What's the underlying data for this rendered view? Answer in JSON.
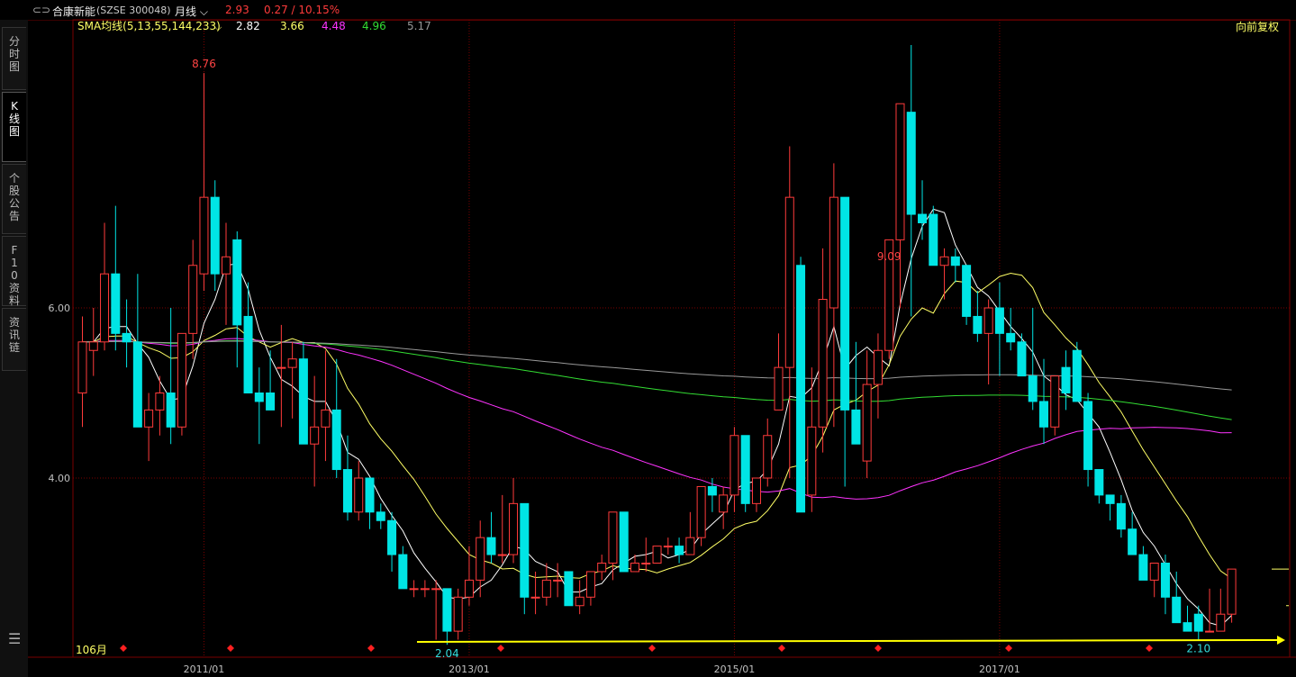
{
  "header": {
    "window_icon": "link-icon",
    "stock_name": "合康新能",
    "stock_code": "(SZSE 300048)",
    "period": "月线",
    "last_price": "2.93",
    "change": "0.27 / 10.15%"
  },
  "sma": {
    "label": "SMA均线(5,13,55,144,233)",
    "values": [
      {
        "value": "2.82",
        "color": "#ffffff"
      },
      {
        "value": "3.66",
        "color": "#ffff66"
      },
      {
        "value": "4.48",
        "color": "#ff33ff"
      },
      {
        "value": "4.96",
        "color": "#33dd33"
      },
      {
        "value": "5.17",
        "color": "#999999"
      }
    ]
  },
  "adjust_label": "向前复权",
  "side_tabs": [
    "分时图",
    "K线图",
    "个股公告",
    "F10资料",
    "资讯链"
  ],
  "active_tab": 1,
  "menu_icon": "hamburger-menu-icon",
  "bottom_label": "106月",
  "colors": {
    "up": "#ff3b3b",
    "down": "#00e5e5",
    "grid": "#7a0000",
    "axis_text": "#c0c0c0"
  },
  "chart_data": {
    "type": "candlestick",
    "y_tick_labels": [
      "6.00",
      "4.00"
    ],
    "x_tick_labels": [
      "2011/01",
      "2013/01",
      "2015/01",
      "2017/01"
    ],
    "high_annotations": [
      {
        "index": 11,
        "value": "8.76"
      },
      {
        "index": 73,
        "value": "9.09"
      }
    ],
    "low_annotations": [
      {
        "index": 33,
        "value": "2.04"
      },
      {
        "index": 101,
        "value": "2.10"
      }
    ],
    "ohlc": [
      [
        5.0,
        5.9,
        4.6,
        5.6
      ],
      [
        5.5,
        6.0,
        5.2,
        5.6
      ],
      [
        5.6,
        7.0,
        5.5,
        6.4
      ],
      [
        6.4,
        7.2,
        5.5,
        5.7
      ],
      [
        5.7,
        6.1,
        5.3,
        5.6
      ],
      [
        5.6,
        6.4,
        5.0,
        4.6
      ],
      [
        4.6,
        5.0,
        4.2,
        4.8
      ],
      [
        4.8,
        5.2,
        4.5,
        5.0
      ],
      [
        5.0,
        6.0,
        4.4,
        4.6
      ],
      [
        4.6,
        5.7,
        4.5,
        5.7
      ],
      [
        5.7,
        6.8,
        5.4,
        6.5
      ],
      [
        6.4,
        8.76,
        6.2,
        7.3
      ],
      [
        7.3,
        7.5,
        6.2,
        6.4
      ],
      [
        6.4,
        7.0,
        5.8,
        6.6
      ],
      [
        6.8,
        6.9,
        5.3,
        5.8
      ],
      [
        5.9,
        6.3,
        5.0,
        5.0
      ],
      [
        5.0,
        5.3,
        4.4,
        4.9
      ],
      [
        5.0,
        5.5,
        4.8,
        4.8
      ],
      [
        5.3,
        5.8,
        4.6,
        5.3
      ],
      [
        5.3,
        5.6,
        4.7,
        5.4
      ],
      [
        5.4,
        5.6,
        4.4,
        4.4
      ],
      [
        4.4,
        5.2,
        3.9,
        4.6
      ],
      [
        4.6,
        5.5,
        4.2,
        4.8
      ],
      [
        4.8,
        5.4,
        4.0,
        4.1
      ],
      [
        4.1,
        4.5,
        3.5,
        3.6
      ],
      [
        3.6,
        4.2,
        3.5,
        4.0
      ],
      [
        4.0,
        4.0,
        3.4,
        3.6
      ],
      [
        3.6,
        3.7,
        3.4,
        3.5
      ],
      [
        3.5,
        3.6,
        2.9,
        3.1
      ],
      [
        3.1,
        3.2,
        2.7,
        2.7
      ],
      [
        2.7,
        2.8,
        2.6,
        2.7
      ],
      [
        2.7,
        2.8,
        2.6,
        2.7
      ],
      [
        2.7,
        2.8,
        2.1,
        2.7
      ],
      [
        2.7,
        2.7,
        2.04,
        2.2
      ],
      [
        2.2,
        2.7,
        2.1,
        2.6
      ],
      [
        2.6,
        3.2,
        2.5,
        2.8
      ],
      [
        2.8,
        3.5,
        2.6,
        3.3
      ],
      [
        3.3,
        3.6,
        3.0,
        3.1
      ],
      [
        3.1,
        3.8,
        3.0,
        3.1
      ],
      [
        3.1,
        4.0,
        3.0,
        3.7
      ],
      [
        3.7,
        3.7,
        2.4,
        2.6
      ],
      [
        2.6,
        2.9,
        2.4,
        2.6
      ],
      [
        2.6,
        3.0,
        2.5,
        2.8
      ],
      [
        2.8,
        3.0,
        2.6,
        2.8
      ],
      [
        2.9,
        2.9,
        2.5,
        2.5
      ],
      [
        2.5,
        2.8,
        2.4,
        2.6
      ],
      [
        2.6,
        2.9,
        2.5,
        2.9
      ],
      [
        2.9,
        3.1,
        2.8,
        3.0
      ],
      [
        3.0,
        3.5,
        2.8,
        3.6
      ],
      [
        3.6,
        3.6,
        2.9,
        2.9
      ],
      [
        2.9,
        3.1,
        2.9,
        3.0
      ],
      [
        3.0,
        3.3,
        2.9,
        3.0
      ],
      [
        3.0,
        3.2,
        3.1,
        3.2
      ],
      [
        3.2,
        3.3,
        3.1,
        3.2
      ],
      [
        3.2,
        3.3,
        3.0,
        3.1
      ],
      [
        3.1,
        3.6,
        3.1,
        3.3
      ],
      [
        3.3,
        3.9,
        3.2,
        3.9
      ],
      [
        3.9,
        4.0,
        3.6,
        3.8
      ],
      [
        3.6,
        3.9,
        3.4,
        3.8
      ],
      [
        3.8,
        4.6,
        3.6,
        4.5
      ],
      [
        4.5,
        4.5,
        3.6,
        3.7
      ],
      [
        3.7,
        4.0,
        3.6,
        4.0
      ],
      [
        4.0,
        4.7,
        3.9,
        4.5
      ],
      [
        4.8,
        5.7,
        4.8,
        5.3
      ],
      [
        5.3,
        7.9,
        4.0,
        7.3
      ],
      [
        6.5,
        6.6,
        3.7,
        3.6
      ],
      [
        3.8,
        5.3,
        3.6,
        4.6
      ],
      [
        4.6,
        6.7,
        4.3,
        6.1
      ],
      [
        6.0,
        7.7,
        4.6,
        7.3
      ],
      [
        7.3,
        7.3,
        3.9,
        4.8
      ],
      [
        4.8,
        5.6,
        4.4,
        4.4
      ],
      [
        4.2,
        5.5,
        4.0,
        5.1
      ],
      [
        5.1,
        5.7,
        4.7,
        5.5
      ],
      [
        5.5,
        6.5,
        5.4,
        6.8
      ],
      [
        6.8,
        7.5,
        6.0,
        8.4
      ],
      [
        8.3,
        9.09,
        5.9,
        7.1
      ],
      [
        7.1,
        7.5,
        6.8,
        7.0
      ],
      [
        7.1,
        7.2,
        6.5,
        6.5
      ],
      [
        6.5,
        6.7,
        6.1,
        6.6
      ],
      [
        6.6,
        6.7,
        6.3,
        6.5
      ],
      [
        6.5,
        6.5,
        5.8,
        5.9
      ],
      [
        5.9,
        6.2,
        5.6,
        5.7
      ],
      [
        5.7,
        6.1,
        5.1,
        6.0
      ],
      [
        6.0,
        6.3,
        5.2,
        5.7
      ],
      [
        5.7,
        6.0,
        5.5,
        5.6
      ],
      [
        5.6,
        5.7,
        5.2,
        5.2
      ],
      [
        5.2,
        6.0,
        4.8,
        4.9
      ],
      [
        4.9,
        5.4,
        4.4,
        4.6
      ],
      [
        4.6,
        5.2,
        4.5,
        5.2
      ],
      [
        5.3,
        5.5,
        4.8,
        5.0
      ],
      [
        5.5,
        5.6,
        4.9,
        4.9
      ],
      [
        4.9,
        5.0,
        3.9,
        4.1
      ],
      [
        4.1,
        4.1,
        3.7,
        3.8
      ],
      [
        3.8,
        3.8,
        3.5,
        3.7
      ],
      [
        3.7,
        3.8,
        3.3,
        3.4
      ],
      [
        3.4,
        3.6,
        3.1,
        3.1
      ],
      [
        3.1,
        3.2,
        2.8,
        2.8
      ],
      [
        2.8,
        3.0,
        2.6,
        3.0
      ],
      [
        3.0,
        3.1,
        2.4,
        2.6
      ],
      [
        2.6,
        2.9,
        2.4,
        2.3
      ],
      [
        2.3,
        2.5,
        2.2,
        2.2
      ],
      [
        2.4,
        2.5,
        2.1,
        2.2
      ],
      [
        2.2,
        2.7,
        2.2,
        2.2
      ],
      [
        2.2,
        2.7,
        2.2,
        2.4
      ],
      [
        2.4,
        2.8,
        2.3,
        2.93
      ]
    ],
    "ma_lines": [
      {
        "period": 5,
        "color": "#ffffff"
      },
      {
        "period": 13,
        "color": "#ffff66"
      },
      {
        "period": 55,
        "color": "#ff33ff"
      },
      {
        "period": 144,
        "color": "#33dd33"
      },
      {
        "period": 233,
        "color": "#999999"
      }
    ]
  }
}
